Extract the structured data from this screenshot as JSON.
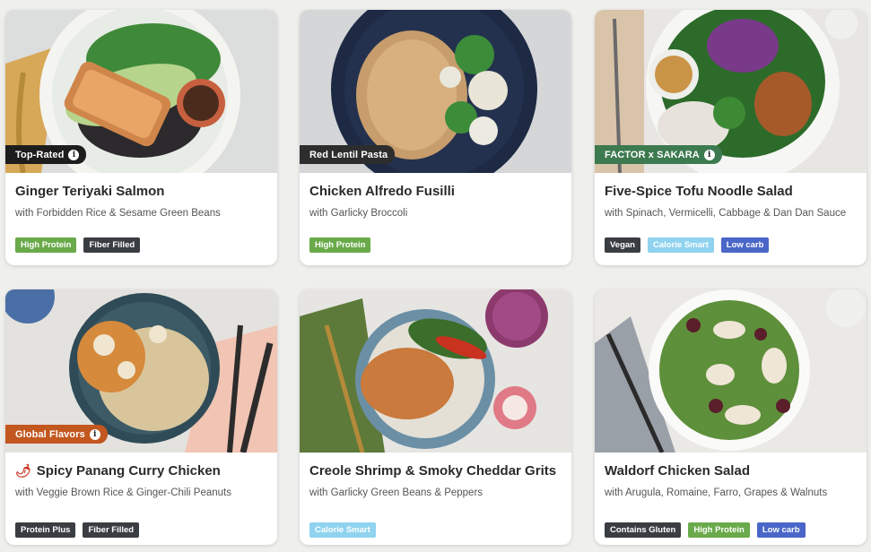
{
  "meals": [
    {
      "badge": "Top-Rated",
      "badge_style": "top",
      "badge_info": true,
      "title": "Ginger Teriyaki Salmon",
      "subtitle": "with Forbidden Rice & Sesame Green Beans",
      "spicy": false,
      "tags": [
        {
          "label": "High Protein",
          "color": "#6aaa4a"
        },
        {
          "label": "Fiber Filled",
          "color": "#3a3d42"
        }
      ]
    },
    {
      "badge": "Red Lentil Pasta",
      "badge_style": "dark",
      "badge_info": false,
      "title": "Chicken Alfredo Fusilli",
      "subtitle": "with Garlicky Broccoli",
      "spicy": false,
      "tags": [
        {
          "label": "High Protein",
          "color": "#6aaa4a"
        }
      ]
    },
    {
      "badge": "FACTOR x SAKARA",
      "badge_style": "green",
      "badge_info": true,
      "title": "Five-Spice Tofu Noodle Salad",
      "subtitle": "with Spinach, Vermicelli, Cabbage & Dan Dan Sauce",
      "spicy": false,
      "tags": [
        {
          "label": "Vegan",
          "color": "#3a3d42"
        },
        {
          "label": "Calorie Smart",
          "color": "#8fd3ef"
        },
        {
          "label": "Low carb",
          "color": "#4a66c8"
        }
      ]
    },
    {
      "badge": "Global Flavors",
      "badge_style": "orange",
      "badge_info": true,
      "title": "Spicy Panang Curry Chicken",
      "subtitle": "with Veggie Brown Rice & Ginger-Chili Peanuts",
      "spicy": true,
      "tags": [
        {
          "label": "Protein Plus",
          "color": "#3a3d42"
        },
        {
          "label": "Fiber Filled",
          "color": "#3a3d42"
        }
      ]
    },
    {
      "badge": "",
      "badge_style": "",
      "badge_info": false,
      "title": "Creole Shrimp & Smoky Cheddar Grits",
      "subtitle": "with Garlicky Green Beans & Peppers",
      "spicy": false,
      "tags": [
        {
          "label": "Calorie Smart",
          "color": "#8fd3ef"
        }
      ]
    },
    {
      "badge": "",
      "badge_style": "",
      "badge_info": false,
      "title": "Waldorf Chicken Salad",
      "subtitle": "with Arugula, Romaine, Farro, Grapes & Walnuts",
      "spicy": false,
      "tags": [
        {
          "label": "Contains Gluten",
          "color": "#3a3d42"
        },
        {
          "label": "High Protein",
          "color": "#6aaa4a"
        },
        {
          "label": "Low carb",
          "color": "#4a66c8"
        }
      ]
    }
  ],
  "icons": {
    "info": "info-icon",
    "chili": "chili-pepper-icon",
    "info_glyph": "i",
    "chili_glyph": "🌶"
  }
}
